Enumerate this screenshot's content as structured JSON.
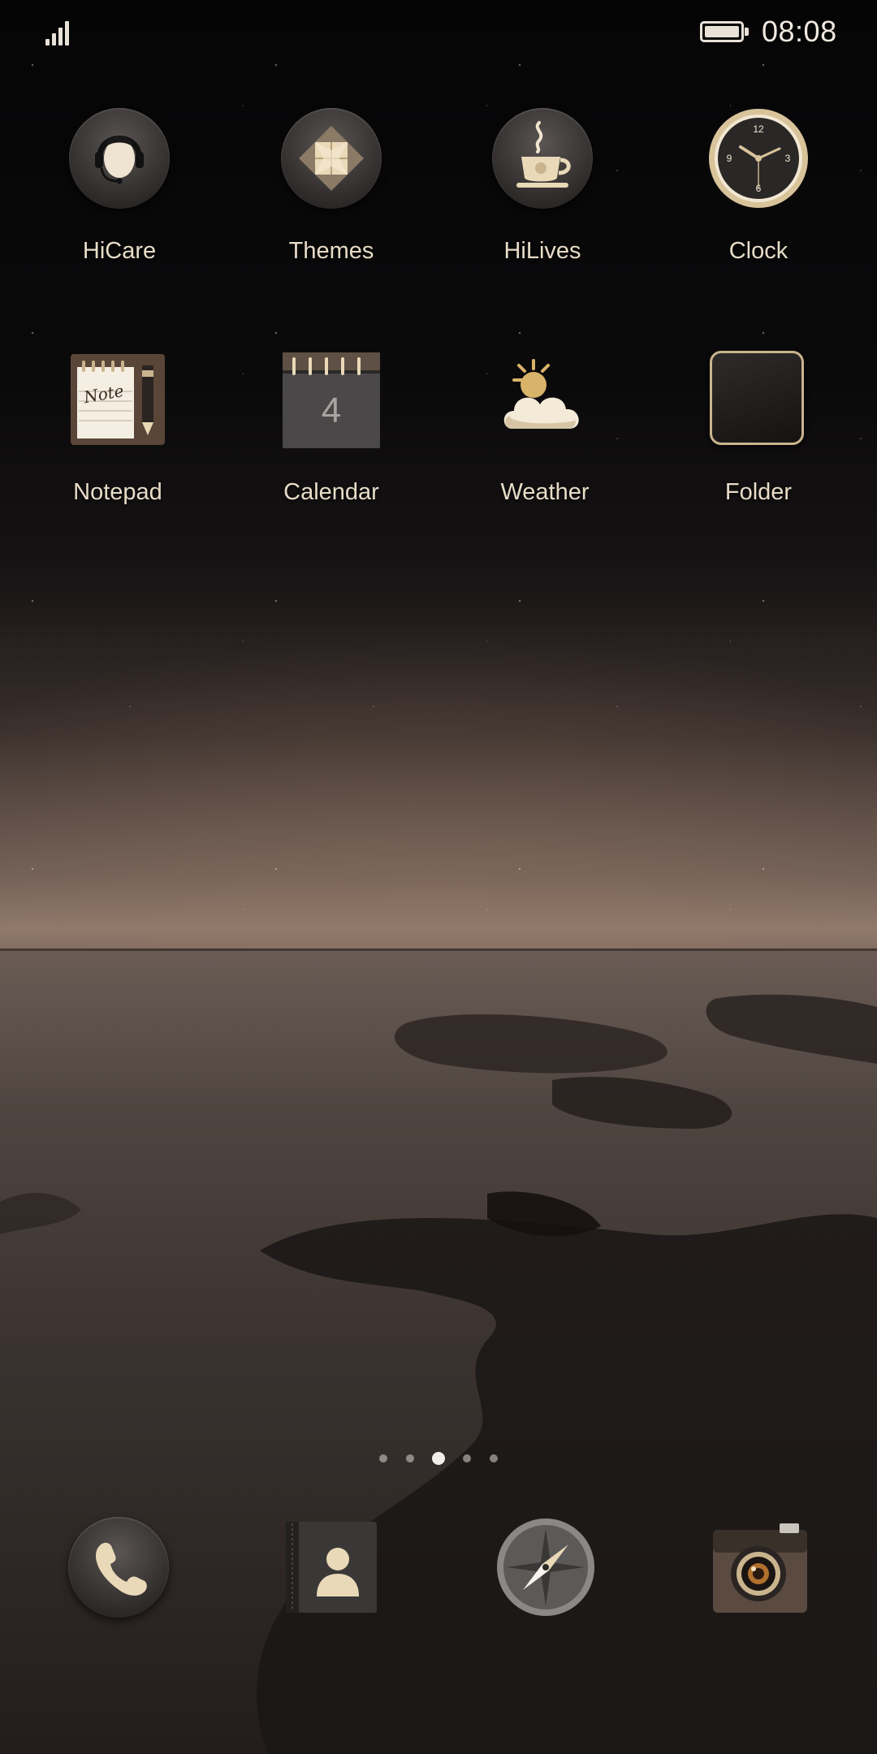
{
  "status_bar": {
    "time": "08:08",
    "signal_icon": "signal-bars-icon",
    "battery_icon": "battery-full-icon"
  },
  "apps": [
    {
      "label": "HiCare",
      "icon": "headset-person-icon"
    },
    {
      "label": "Themes",
      "icon": "themes-diamond-icon"
    },
    {
      "label": "HiLives",
      "icon": "coffee-cup-icon"
    },
    {
      "label": "Clock",
      "icon": "analog-clock-icon"
    },
    {
      "label": "Notepad",
      "icon": "notepad-icon",
      "icon_text": "Note"
    },
    {
      "label": "Calendar",
      "icon": "calendar-icon",
      "icon_text": "4"
    },
    {
      "label": "Weather",
      "icon": "sun-cloud-icon"
    },
    {
      "label": "Folder",
      "icon": "folder-icon"
    }
  ],
  "clock_face": {
    "numbers": [
      "12",
      "3",
      "6",
      "9"
    ]
  },
  "page_indicator": {
    "count": 5,
    "active": 3
  },
  "dock": [
    {
      "name": "phone",
      "icon": "phone-handset-icon"
    },
    {
      "name": "contacts",
      "icon": "contacts-book-icon"
    },
    {
      "name": "browser",
      "icon": "compass-icon"
    },
    {
      "name": "camera",
      "icon": "camera-icon"
    }
  ],
  "colors": {
    "label": "#e8dcc8",
    "accent_gold": "#d8c39a"
  }
}
